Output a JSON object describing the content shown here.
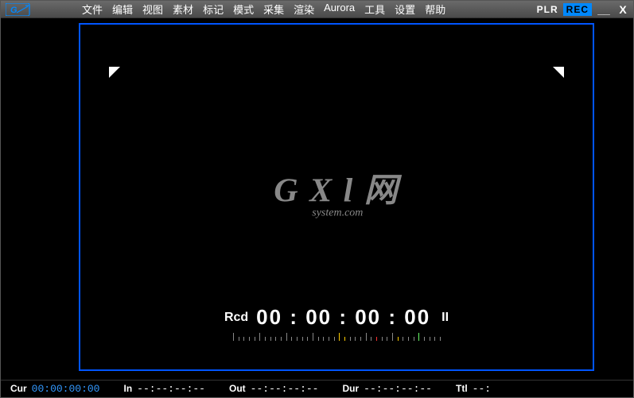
{
  "titlebar": {
    "plr": "PLR",
    "rec": "REC"
  },
  "menu": {
    "items": [
      "文件",
      "编辑",
      "视图",
      "素材",
      "标记",
      "模式",
      "采集",
      "渲染",
      "Aurora",
      "工具",
      "设置",
      "帮助"
    ]
  },
  "watermark": {
    "main": "G X l 网",
    "sub": "system.com"
  },
  "rcd": {
    "label": "Rcd",
    "time": "00 : 00 : 00 : 00",
    "pause": "II"
  },
  "status": {
    "cur": {
      "label": "Cur",
      "value": "00:00:00:00"
    },
    "in": {
      "label": "In",
      "value": "--:--:--:--"
    },
    "out": {
      "label": "Out",
      "value": "--:--:--:--"
    },
    "dur": {
      "label": "Dur",
      "value": "--:--:--:--"
    },
    "ttl": {
      "label": "Ttl",
      "value": "--:"
    }
  }
}
